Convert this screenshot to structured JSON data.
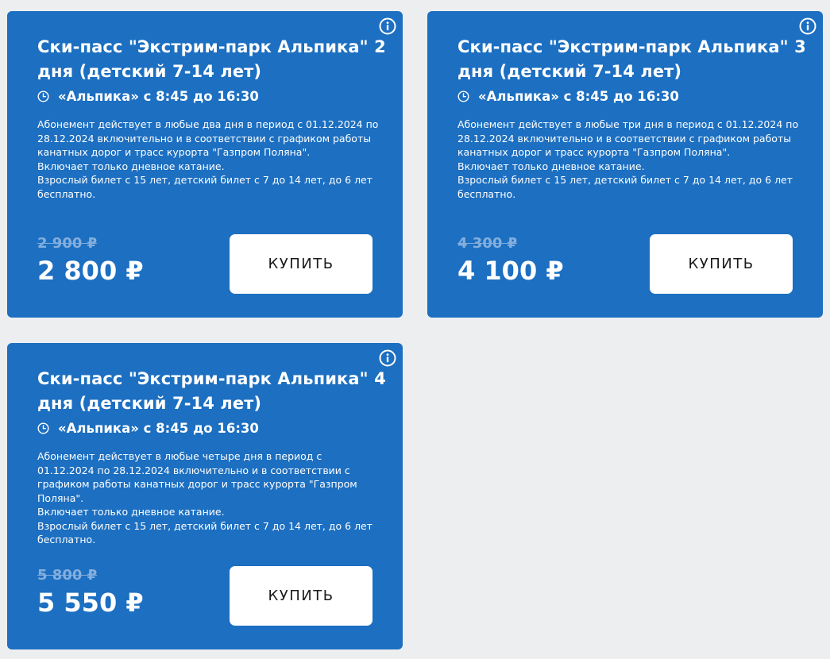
{
  "cards": [
    {
      "title": "Ски-пасс \"Экстрим-парк Альпика\" 2 дня (детский 7-14 лет)",
      "schedule": "«Альпика» с 8:45 до 16:30",
      "desc_1": "Абонемент действует в любые два дня в период с 01.12.2024 по 28.12.2024 включительно и в соответствии с графиком работы канатных дорог и трасс курорта \"Газпром Поляна\".",
      "desc_2": "Включает только дневное катание.",
      "desc_3": "Взрослый билет с 15 лет, детский билет с 7 до 14 лет, до 6 лет бесплатно.",
      "old_price": "2 900 ₽",
      "new_price": "2 800 ₽",
      "buy_label": "КУПИТЬ"
    },
    {
      "title": "Ски-пасс \"Экстрим-парк Альпика\" 3 дня (детский 7-14 лет)",
      "schedule": "«Альпика» с 8:45 до 16:30",
      "desc_1": "Абонемент действует в любые три дня в период с 01.12.2024 по 28.12.2024 включительно и в соответствии с графиком работы канатных дорог и трасс курорта \"Газпром Поляна\".",
      "desc_2": "Включает только дневное катание.",
      "desc_3": "Взрослый билет с 15 лет, детский билет с 7 до 14 лет, до 6 лет бесплатно.",
      "old_price": "4 300 ₽",
      "new_price": "4 100 ₽",
      "buy_label": "КУПИТЬ"
    },
    {
      "title": "Ски-пасс \"Экстрим-парк Альпика\" 4 дня (детский 7-14 лет)",
      "schedule": "«Альпика» с 8:45 до 16:30",
      "desc_1": "Абонемент действует в любые четыре дня в период с 01.12.2024 по 28.12.2024 включительно и в соответствии с графиком работы канатных дорог и трасс курорта \"Газпром Поляна\".",
      "desc_2": "Включает только дневное катание.",
      "desc_3": "Взрослый билет с 15 лет, детский билет с 7 до 14 лет, до 6 лет бесплатно.",
      "old_price": "5 800 ₽",
      "new_price": "5 550 ₽",
      "buy_label": "КУПИТЬ"
    }
  ],
  "colors": {
    "card_bg": "#1c6fc1",
    "page_bg": "#edeef0",
    "old_price": "#84aedd",
    "button_bg": "#ffffff"
  },
  "icons": {
    "info": "info-icon",
    "clock": "clock-icon"
  }
}
